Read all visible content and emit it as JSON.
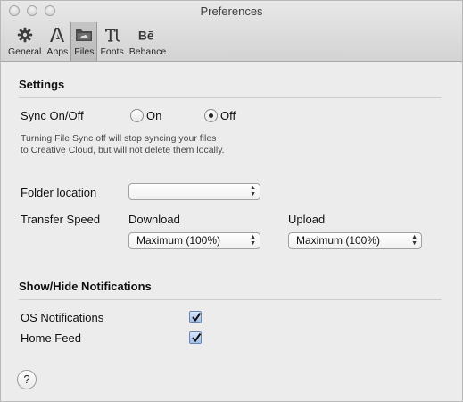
{
  "window": {
    "title": "Preferences"
  },
  "toolbar": {
    "items": [
      {
        "label": "General",
        "icon": "gear-icon"
      },
      {
        "label": "Apps",
        "icon": "adobe-logo-icon"
      },
      {
        "label": "Files",
        "icon": "folder-icon",
        "selected": true
      },
      {
        "label": "Fonts",
        "icon": "typekit-icon"
      },
      {
        "label": "Behance",
        "icon": "behance-icon"
      }
    ]
  },
  "settings": {
    "section_title": "Settings",
    "sync_label": "Sync On/Off",
    "sync_on_label": "On",
    "sync_off_label": "Off",
    "sync_value": "Off",
    "hint_line1": "Turning File Sync off will stop syncing your files",
    "hint_line2": "to Creative Cloud, but will not delete them locally.",
    "folder_location_label": "Folder location",
    "folder_location_value": "",
    "transfer_speed_label": "Transfer Speed",
    "download_label": "Download",
    "download_value": "Maximum (100%)",
    "upload_label": "Upload",
    "upload_value": "Maximum (100%)"
  },
  "notifications": {
    "section_title": "Show/Hide Notifications",
    "os_label": "OS Notifications",
    "os_checked": true,
    "home_feed_label": "Home Feed",
    "home_feed_checked": true
  },
  "help": {
    "label": "?"
  }
}
